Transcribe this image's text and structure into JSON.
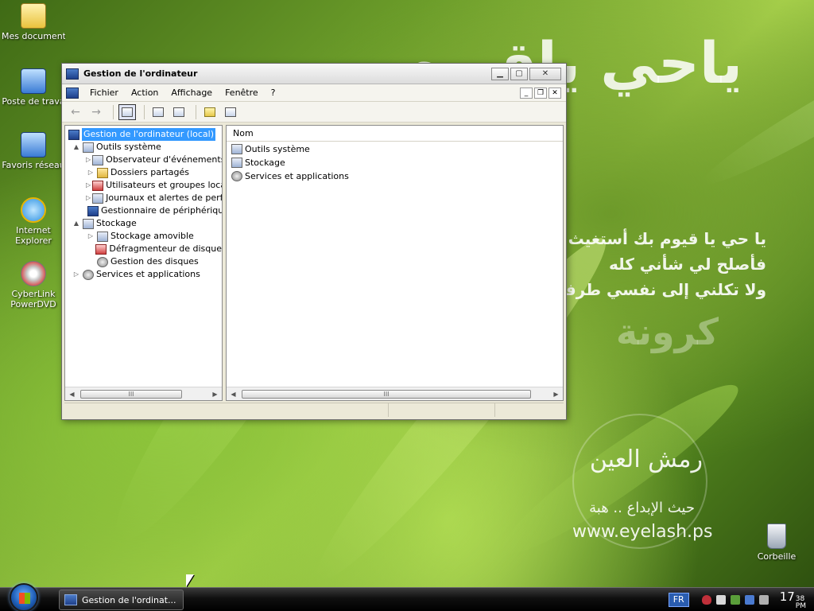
{
  "desktop": {
    "icons": [
      {
        "label": "Mes documents",
        "color": "#e9c23d"
      },
      {
        "label": "Poste de trava",
        "color": "#3a7bd5"
      },
      {
        "label": "Favoris réseau",
        "color": "#3a7bd5"
      },
      {
        "label": "Internet Explorer",
        "color": "#2a8fe0"
      },
      {
        "label": "CyberLink PowerDVD",
        "color": "#d33"
      },
      {
        "label": "Corbeille",
        "color": "#c0c8d4"
      }
    ],
    "wallpaper": {
      "title_ar": "ياحي ياقيوم",
      "line1": "يا حي يا قيوم بك أستغيث",
      "line2": "فأصلح لي شأني كله",
      "line3": "ولا تكلني إلى نفسي طرفة عين",
      "big": "كرونة",
      "logo": "رمش العين",
      "sub": "حيث الإبداع .. هبة",
      "url": "www.eyelash.ps"
    }
  },
  "window": {
    "title": "Gestion de l'ordinateur",
    "buttons": {
      "minimize": "▁",
      "maximize": "▢",
      "close": "✕"
    },
    "menu": [
      "Fichier",
      "Action",
      "Affichage",
      "Fenêtre",
      "?"
    ],
    "mdi_buttons": {
      "minimize": "_",
      "restore": "❐",
      "close": "✕"
    },
    "toolbar": {
      "back": "←",
      "forward": "→"
    },
    "tree": {
      "root": "Gestion de l'ordinateur (local)",
      "items": [
        {
          "label": "Outils système",
          "level": 1,
          "expander": "▲",
          "icon": "tools"
        },
        {
          "label": "Observateur d'événements",
          "level": 2,
          "expander": "▷",
          "icon": "event"
        },
        {
          "label": "Dossiers partagés",
          "level": 2,
          "expander": "▷",
          "icon": "folder"
        },
        {
          "label": "Utilisateurs et groupes locaux",
          "level": 2,
          "expander": "▷",
          "icon": "users"
        },
        {
          "label": "Journaux et alertes de performance",
          "level": 2,
          "expander": "▷",
          "icon": "perf"
        },
        {
          "label": "Gestionnaire de périphériques",
          "level": 2,
          "expander": "",
          "icon": "device"
        },
        {
          "label": "Stockage",
          "level": 1,
          "expander": "▲",
          "icon": "storage"
        },
        {
          "label": "Stockage amovible",
          "level": 2,
          "expander": "▷",
          "icon": "removable"
        },
        {
          "label": "Défragmenteur de disque",
          "level": 2,
          "expander": "",
          "icon": "defrag"
        },
        {
          "label": "Gestion des disques",
          "level": 2,
          "expander": "",
          "icon": "disk"
        },
        {
          "label": "Services et applications",
          "level": 1,
          "expander": "▷",
          "icon": "services"
        }
      ]
    },
    "list": {
      "header": "Nom",
      "items": [
        "Outils système",
        "Stockage",
        "Services et applications"
      ]
    },
    "scroll": {
      "left": "◀",
      "right": "▶",
      "grip": "III"
    }
  },
  "taskbar": {
    "task_label": "Gestion de l'ordinat...",
    "lang": "FR",
    "clock_hour": "17",
    "clock_min": "38",
    "clock_ampm": "PM"
  }
}
